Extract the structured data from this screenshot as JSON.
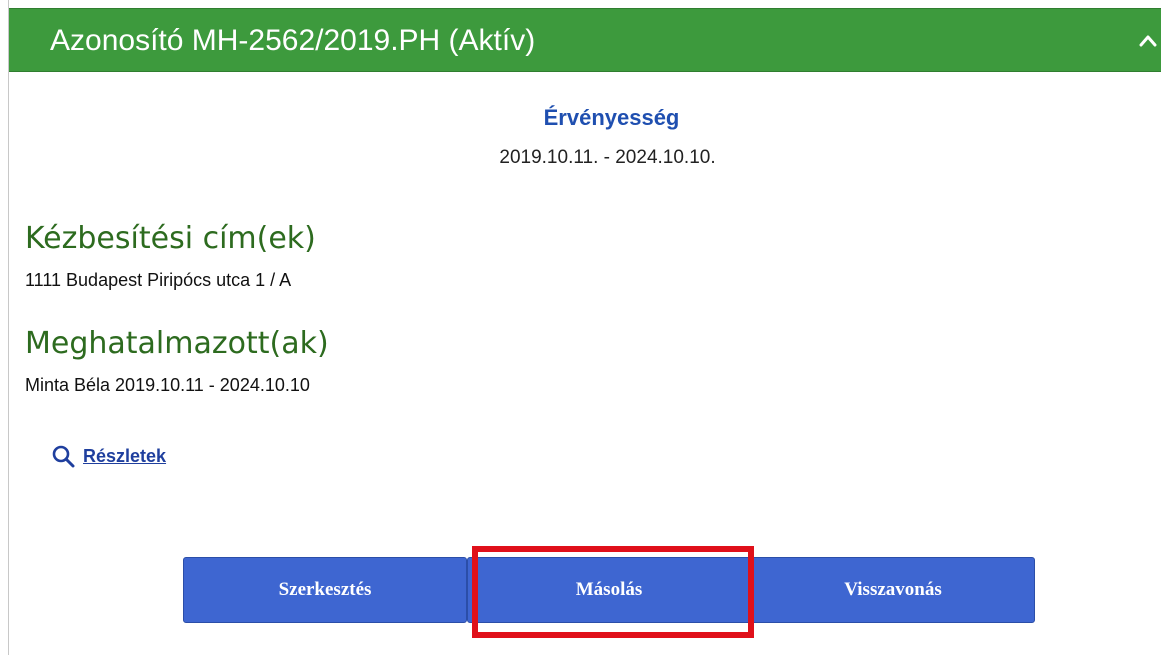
{
  "header": {
    "title": "Azonosító MH-2562/2019.PH (Aktív)",
    "collapse_icon": "chevron-up-icon"
  },
  "validity": {
    "title": "Érvényesség",
    "range": "2019.10.11. - 2024.10.10."
  },
  "delivery": {
    "title": "Kézbesítési cím(ek)",
    "address": "1111 Budapest Piripócs utca 1 / A"
  },
  "representatives": {
    "title": "Meghatalmazott(ak)",
    "entry": "Minta Béla 2019.10.11 - 2024.10.10"
  },
  "details": {
    "icon": "search-icon",
    "label": "Részletek"
  },
  "actions": {
    "edit_label": "Szerkesztés",
    "copy_label": "Másolás",
    "revoke_label": "Visszavonás"
  },
  "colors": {
    "header_bg": "#3d9a3d",
    "section_title": "#2d6b1f",
    "validity_title": "#1f4fb0",
    "button_bg": "#3e66d1",
    "highlight": "#e0101a"
  }
}
